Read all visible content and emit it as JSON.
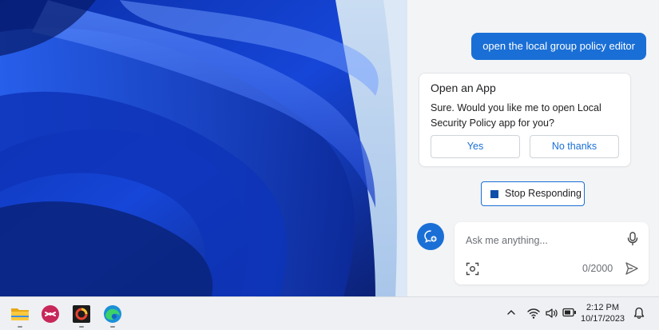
{
  "chat": {
    "user_message": "open the local group policy editor",
    "card": {
      "title": "Open an App",
      "text": "Sure. Would you like me to open Local Security Policy app for you?",
      "yes_label": "Yes",
      "no_label": "No thanks"
    },
    "stop_label": "Stop Responding",
    "input": {
      "placeholder": "Ask me anything...",
      "value": "",
      "counter": "0/2000"
    }
  },
  "taskbar": {
    "apps": [
      "file-explorer-icon",
      "screenshot-tool-icon",
      "recorder-icon",
      "edge-icon"
    ],
    "time": "2:12 PM",
    "date": "10/17/2023"
  },
  "colors": {
    "accent": "#1a6fd6",
    "panel_bg": "#f3f4f6",
    "wallpaper_blue": "#1646d8"
  }
}
